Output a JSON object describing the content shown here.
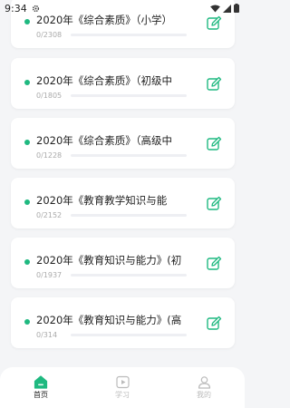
{
  "status_bar": {
    "time": "9:34"
  },
  "colors": {
    "accent": "#1fb980",
    "background": "#f4f5f7",
    "muted": "#aaaaaa"
  },
  "courses": [
    {
      "title": "2020年《综合素质》（小学）",
      "count": "0/2308",
      "progress": 0
    },
    {
      "title": "2020年《综合素质》（初级中",
      "count": "0/1805",
      "progress": 0
    },
    {
      "title": "2020年《综合素质》（高级中",
      "count": "0/1228",
      "progress": 0
    },
    {
      "title": "2020年《教育教学知识与能",
      "count": "0/2152",
      "progress": 0
    },
    {
      "title": "2020年《教育知识与能力》(初",
      "count": "0/1937",
      "progress": 0
    },
    {
      "title": "2020年《教育知识与能力》(高",
      "count": "0/314",
      "progress": 0
    }
  ],
  "tabbar": {
    "home": {
      "label": "首页",
      "icon": "home-icon",
      "active": true
    },
    "study": {
      "label": "学习",
      "icon": "play-icon",
      "active": false
    },
    "mine": {
      "label": "我的",
      "icon": "user-icon",
      "active": false
    }
  }
}
